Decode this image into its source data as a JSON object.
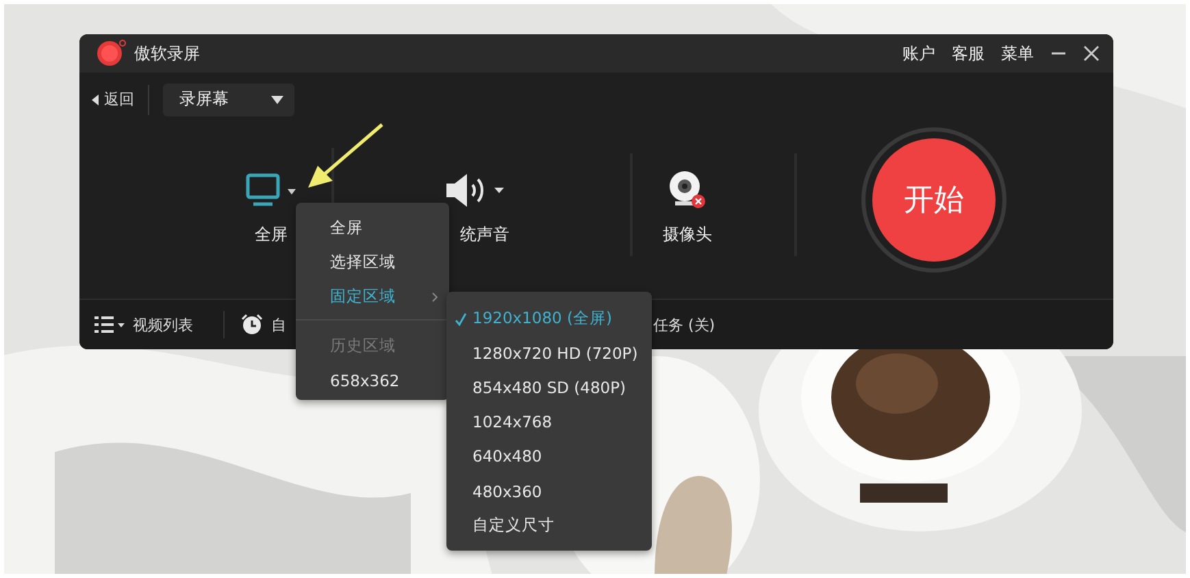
{
  "window": {
    "title": "傲软录屏",
    "header_links": [
      "账户",
      "客服",
      "菜单"
    ],
    "back": "返回",
    "mode_dropdown": "录屏幕",
    "sources": [
      {
        "kind": "screen",
        "label": "全屏"
      },
      {
        "kind": "audio",
        "label": "统声音"
      },
      {
        "kind": "camera",
        "label": "摄像头"
      }
    ],
    "start_button": "开始",
    "bottom_bar": [
      {
        "kind": "list",
        "label": "视频列表"
      },
      {
        "kind": "alarm",
        "label": "自"
      },
      {
        "kind": "plain",
        "label": "任务 (关)"
      }
    ]
  },
  "area_menu": {
    "items": [
      {
        "kind": "item",
        "label": "全屏",
        "selected": false,
        "disabled": false,
        "has_submenu": false
      },
      {
        "kind": "item",
        "label": "选择区域",
        "selected": false,
        "disabled": false,
        "has_submenu": false
      },
      {
        "kind": "item",
        "label": "固定区域",
        "selected": true,
        "disabled": false,
        "has_submenu": true
      },
      {
        "kind": "separator"
      },
      {
        "kind": "item",
        "label": "历史区域",
        "selected": false,
        "disabled": true,
        "has_submenu": false
      },
      {
        "kind": "item",
        "label": "658x362",
        "selected": false,
        "disabled": false,
        "has_submenu": false
      }
    ]
  },
  "size_submenu": {
    "items": [
      {
        "label": "1920x1080 (全屏)",
        "checked": true
      },
      {
        "label": "1280x720 HD (720P)",
        "checked": false
      },
      {
        "label": "854x480 SD (480P)",
        "checked": false
      },
      {
        "label": "1024x768",
        "checked": false
      },
      {
        "label": "640x480",
        "checked": false
      },
      {
        "label": "480x360",
        "checked": false
      },
      {
        "label": "自定义尺寸",
        "checked": false
      }
    ]
  }
}
